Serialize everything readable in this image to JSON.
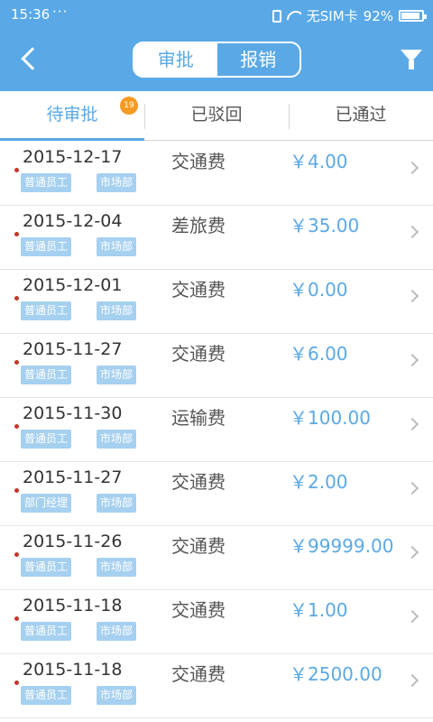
{
  "status_bar": {
    "time": "15:36",
    "dots": "···",
    "carrier": "无SIM卡",
    "battery": "92%"
  },
  "header": {
    "segments": [
      {
        "label": "审批",
        "active": true
      },
      {
        "label": "报销",
        "active": false
      }
    ],
    "accent_color": "#5aa9e6"
  },
  "tabs": [
    {
      "label": "待审批",
      "badge": "19",
      "active": true
    },
    {
      "label": "已驳回"
    },
    {
      "label": "已通过"
    }
  ],
  "rows": [
    {
      "date": "2015-12-17",
      "category": "交通费",
      "amount": "￥4.00",
      "role": "普通员工",
      "dept": "市场部"
    },
    {
      "date": "2015-12-04",
      "category": "差旅费",
      "amount": "￥35.00",
      "role": "普通员工",
      "dept": "市场部"
    },
    {
      "date": "2015-12-01",
      "category": "交通费",
      "amount": "￥0.00",
      "role": "普通员工",
      "dept": "市场部"
    },
    {
      "date": "2015-11-27",
      "category": "交通费",
      "amount": "￥6.00",
      "role": "普通员工",
      "dept": "市场部"
    },
    {
      "date": "2015-11-30",
      "category": "运输费",
      "amount": "￥100.00",
      "role": "普通员工",
      "dept": "市场部"
    },
    {
      "date": "2015-11-27",
      "category": "交通费",
      "amount": "￥2.00",
      "role": "部门经理",
      "dept": "市场部"
    },
    {
      "date": "2015-11-26",
      "category": "交通费",
      "amount": "￥99999.00",
      "role": "普通员工",
      "dept": "市场部"
    },
    {
      "date": "2015-11-18",
      "category": "交通费",
      "amount": "￥1.00",
      "role": "普通员工",
      "dept": "市场部"
    },
    {
      "date": "2015-11-18",
      "category": "交通费",
      "amount": "￥2500.00",
      "role": "普通员工",
      "dept": "市场部"
    }
  ]
}
